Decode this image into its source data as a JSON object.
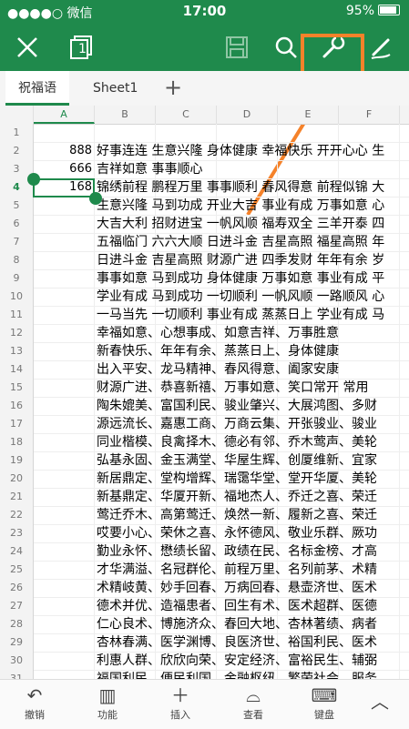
{
  "status": {
    "carrier": "●●●●○ 微信",
    "time": "17:00",
    "battery": "95%"
  },
  "toolbar": {
    "close_icon": "close-icon",
    "sheets_count": "1"
  },
  "tabs": [
    {
      "label": "祝福语"
    },
    {
      "label": "Sheet1"
    }
  ],
  "tab_add": "+",
  "columns": [
    "A",
    "B",
    "C",
    "D",
    "E",
    "F"
  ],
  "rows": [
    {
      "n": "1",
      "a": "",
      "b": ""
    },
    {
      "n": "2",
      "a": "888",
      "b": "好事连连 生意兴隆 身体健康 幸福快乐 开开心心 生"
    },
    {
      "n": "3",
      "a": "666",
      "b": "吉祥如意 事事顺心"
    },
    {
      "n": "4",
      "a": "168",
      "b": "锦绣前程 鹏程万里 事事顺利 春风得意 前程似锦 大"
    },
    {
      "n": "5",
      "a": "",
      "b": "生意兴隆 马到功成 开业大吉 事业有成 万事如意 心"
    },
    {
      "n": "6",
      "a": "",
      "b": "大吉大利 招财进宝 一帆风顺 福寿双全 三羊开泰 四"
    },
    {
      "n": "7",
      "a": "",
      "b": "五福临门 六六大顺 日进斗金 吉星高照 福星高照 年"
    },
    {
      "n": "8",
      "a": "",
      "b": "日进斗金 吉星高照 财源广进 四季发财 年年有余 岁"
    },
    {
      "n": "9",
      "a": "",
      "b": "事事如意 马到成功 身体健康 万事如意 事业有成 平"
    },
    {
      "n": "10",
      "a": "",
      "b": "学业有成 马到成功 一切顺利 一帆风顺 一路顺风 心"
    },
    {
      "n": "11",
      "a": "",
      "b": "一马当先 一切顺利 事业有成 蒸蒸日上 学业有成 马"
    },
    {
      "n": "12",
      "a": "",
      "b": "幸福如意、心想事成、如意吉祥、万事胜意"
    },
    {
      "n": "13",
      "a": "",
      "b": "新春快乐、年年有余、蒸蒸日上、身体健康"
    },
    {
      "n": "14",
      "a": "",
      "b": "出入平安、龙马精神、春风得意、阖家安康"
    },
    {
      "n": "15",
      "a": "",
      "b": "财源广进、恭喜新禧、万事如意、笑口常开 常用"
    },
    {
      "n": "16",
      "a": "",
      "b": "陶朱媲美、富国利民、骏业肇兴、大展鸿图、多财"
    },
    {
      "n": "17",
      "a": "",
      "b": "源远流长、嘉惠工商、万商云集、开张骏业、骏业"
    },
    {
      "n": "18",
      "a": "",
      "b": "同业楷模、良禽择木、德必有邻、乔木莺声、美轮"
    },
    {
      "n": "19",
      "a": "",
      "b": "弘基永固、金玉满堂、华屋生辉、创厦维新、宜家"
    },
    {
      "n": "20",
      "a": "",
      "b": "新居鼎定、堂构增辉、瑞霭华堂、堂开华厦、美轮"
    },
    {
      "n": "21",
      "a": "",
      "b": "新基鼎定、华厦开新、福地杰人、乔迁之喜、荣迁"
    },
    {
      "n": "22",
      "a": "",
      "b": "莺迁乔木、高第莺迁、焕然一新、履新之喜、荣迁"
    },
    {
      "n": "23",
      "a": "",
      "b": "哎要小心、荣休之喜、永怀德风、敬业乐群、厥功"
    },
    {
      "n": "24",
      "a": "",
      "b": "勤业永怀、懋绩长留、政绩在民、名标金榜、才高"
    },
    {
      "n": "25",
      "a": "",
      "b": "才华满溢、名冠群伦、前程万里、名列前茅、术精"
    },
    {
      "n": "26",
      "a": "",
      "b": "术精岐黄、妙手回春、万病回春、悬壶济世、医术"
    },
    {
      "n": "27",
      "a": "",
      "b": "德术并优、造福患者、回生有术、医术超群、医德"
    },
    {
      "n": "28",
      "a": "",
      "b": "仁心良术、博施济众、春回大地、杏林著绩、病者"
    },
    {
      "n": "29",
      "a": "",
      "b": "杏林春满、医学渊博、良医济世、裕国利民、医术"
    },
    {
      "n": "30",
      "a": "",
      "b": "利惠人群、欣欣向荣、安定经济、富裕民生、辅弼"
    },
    {
      "n": "31",
      "a": "",
      "b": "福国利民、便民利国、金融枢纽、繁荣社会、服务"
    }
  ],
  "bottom": [
    {
      "label": "撤销",
      "icon": "undo-icon"
    },
    {
      "label": "功能",
      "icon": "panel-icon"
    },
    {
      "label": "插入",
      "icon": "plus-icon"
    },
    {
      "label": "查看",
      "icon": "glasses-icon"
    },
    {
      "label": "键盘",
      "icon": "keyboard-icon"
    }
  ],
  "accent": "#1f8a4c",
  "highlight_color": "#f5822a"
}
